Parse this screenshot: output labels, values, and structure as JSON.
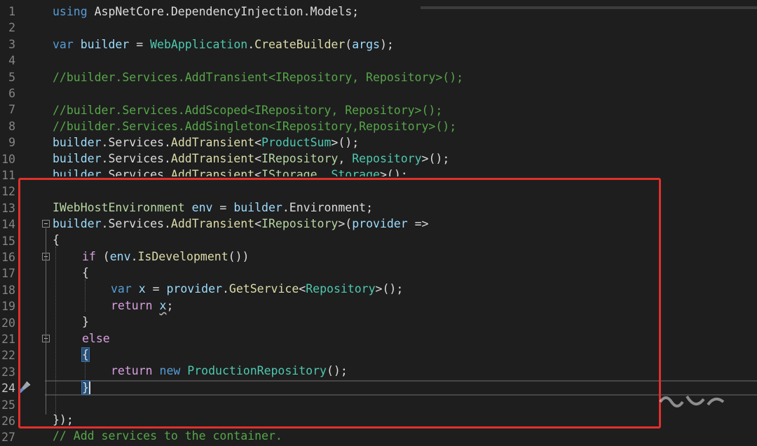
{
  "editor": {
    "line_numbers": [
      "1",
      "2",
      "3",
      "4",
      "5",
      "6",
      "7",
      "8",
      "9",
      "10",
      "11",
      "12",
      "13",
      "14",
      "15",
      "16",
      "17",
      "18",
      "19",
      "20",
      "21",
      "22",
      "23",
      "24",
      "25",
      "26",
      "27"
    ],
    "active_line": "24",
    "colors": {
      "background": "#1e1e1e",
      "keyword": "#569cd6",
      "control_keyword": "#d8a0df",
      "class": "#4ec9b0",
      "interface": "#b8d7a3",
      "method": "#dcdcaa",
      "variable": "#9cdcfe",
      "comment": "#57a64a",
      "highlight_box": "#e0302c"
    },
    "icons": [
      "fold-collapse-icon",
      "quick-actions-brush-icon"
    ]
  },
  "code": {
    "l1": {
      "kw": "using",
      "rest": " AspNetCore.DependencyInjection.Models;"
    },
    "l3": {
      "kw": "var",
      "builder": "builder",
      "eq": " = ",
      "cls": "WebApplication",
      "dot": ".",
      "fn": "CreateBuilder",
      "open": "(",
      "arg": "args",
      "close": ");"
    },
    "l5": "//builder.Services.AddTransient<IRepository, Repository>();",
    "l7": "//builder.Services.AddScoped<IRepository, Repository>();",
    "l8": "//builder.Services.AddSingleton<IRepository,Repository>();",
    "l9": {
      "v": "builder",
      "a": ".Services.",
      "fn": "AddTransient",
      "lt": "<",
      "cls": "ProductSum",
      "end": ">();"
    },
    "l10": {
      "v": "builder",
      "a": ".Services.",
      "fn": "AddTransient",
      "lt": "<",
      "ifc": "IRepository",
      "comma": ", ",
      "cls": "Repository",
      "end": ">();"
    },
    "l11": {
      "v": "builder",
      "a": ".Services.",
      "fn": "AddTransient",
      "lt": "<",
      "ifc": "IStorage",
      "comma": ", ",
      "cls": "Storage",
      "end": ">();"
    },
    "l13": {
      "ifc": "IWebHostEnvironment",
      "env": " env",
      "eq": " = ",
      "v": "builder",
      "rest": ".Environment;"
    },
    "l14": {
      "v": "builder",
      "a": ".Services.",
      "fn": "AddTransient",
      "lt": "<",
      "ifc": "IRepository",
      "gt": ">(",
      "p": "provider",
      "arrow": " =>"
    },
    "l15": "{",
    "l16": {
      "kw": "if",
      "sp": " (",
      "env": "env",
      "dot": ".",
      "fn": "IsDevelopment",
      "end": "())"
    },
    "l17": "{",
    "l18": {
      "kw": "var",
      "x": " x",
      "eq": " = ",
      "p": "provider",
      "dot": ".",
      "fn": "GetService",
      "lt": "<",
      "cls": "Repository",
      "end": ">();"
    },
    "l19": {
      "kw": "return",
      "x": "x",
      "semi": ";"
    },
    "l20": "}",
    "l21": "else",
    "l22": "{",
    "l23": {
      "kw": "return",
      "new": "new",
      "cls": "ProductionRepository",
      "end": "();"
    },
    "l24": "}",
    "l26": "});",
    "l27": "// Add services to the container."
  }
}
